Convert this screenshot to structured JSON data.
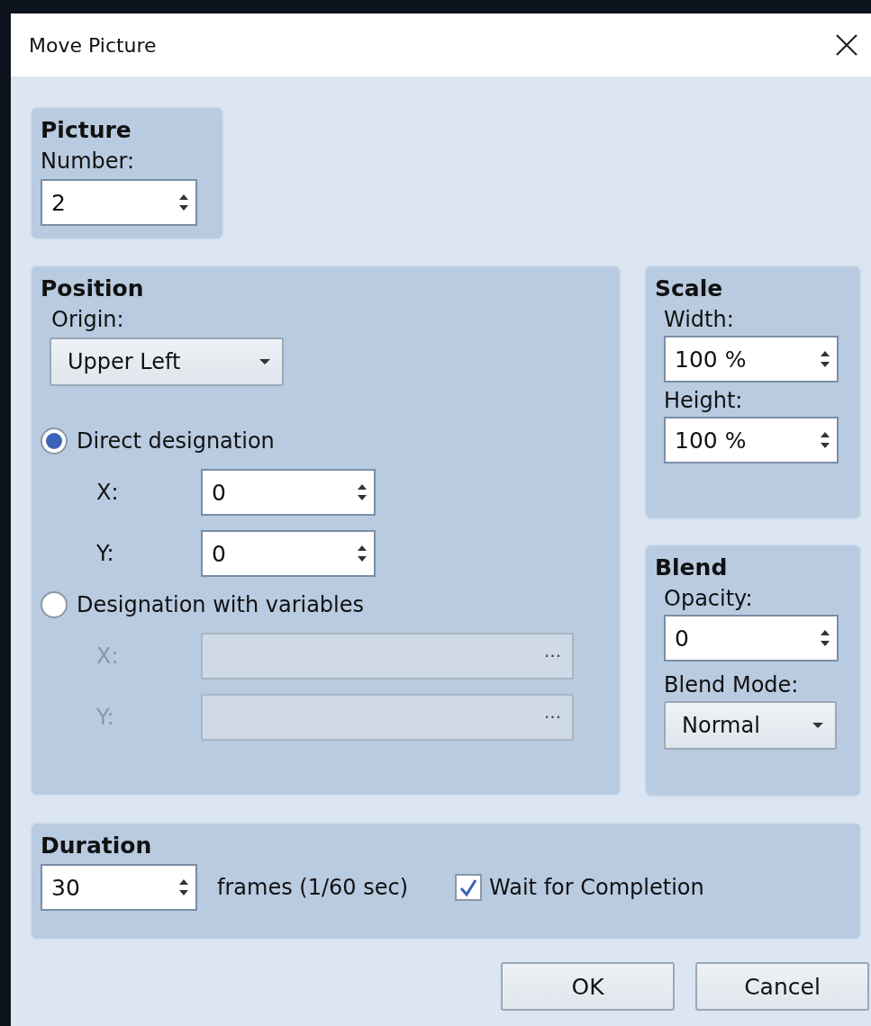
{
  "window": {
    "title": "Move Picture"
  },
  "picture": {
    "title": "Picture",
    "number_label": "Number:",
    "number": "2"
  },
  "position": {
    "title": "Position",
    "origin_label": "Origin:",
    "origin": "Upper Left",
    "options": [
      {
        "label": "Direct designation",
        "selected": true,
        "fields": [
          {
            "label": "X:",
            "value": "0"
          },
          {
            "label": "Y:",
            "value": "0"
          }
        ]
      },
      {
        "label": "Designation with variables",
        "selected": false,
        "fields": [
          {
            "label": "X:",
            "button": "···"
          },
          {
            "label": "Y:",
            "button": "···"
          }
        ]
      }
    ]
  },
  "scale": {
    "title": "Scale",
    "fields": [
      {
        "label": "Width:",
        "value": "100 %"
      },
      {
        "label": "Height:",
        "value": "100 %"
      }
    ]
  },
  "blend": {
    "title": "Blend",
    "opacity_label": "Opacity:",
    "opacity": "0",
    "mode_label": "Blend Mode:",
    "mode": "Normal"
  },
  "duration": {
    "title": "Duration",
    "value": "30",
    "unit": "frames (1/60 sec)",
    "wait": {
      "label": "Wait for Completion",
      "checked": true
    }
  },
  "buttons": [
    "OK",
    "Cancel"
  ]
}
